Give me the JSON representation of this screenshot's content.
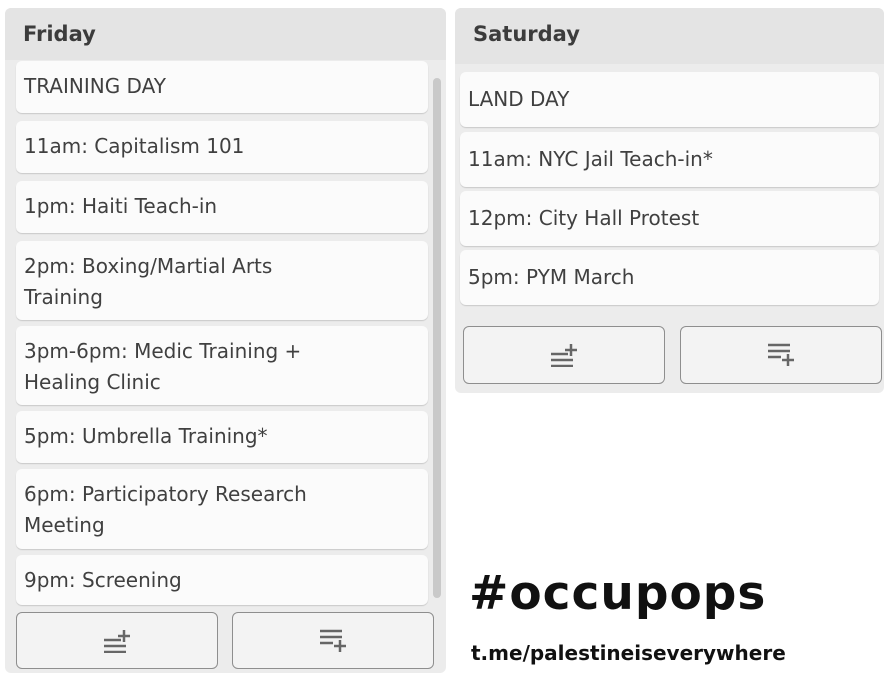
{
  "friday": {
    "title": "Friday",
    "cards": [
      {
        "lines": [
          "TRAINING DAY"
        ]
      },
      {
        "lines": [
          "11am: Capitalism 101"
        ]
      },
      {
        "lines": [
          "1pm: Haiti Teach-in"
        ]
      },
      {
        "lines": [
          "2pm: Boxing/Martial Arts",
          "Training"
        ]
      },
      {
        "lines": [
          "3pm-6pm: Medic Training +",
          "Healing Clinic"
        ]
      },
      {
        "lines": [
          "5pm: Umbrella Training*"
        ]
      },
      {
        "lines": [
          "6pm: Participatory Research",
          "Meeting"
        ]
      },
      {
        "lines": [
          "9pm: Screening"
        ]
      }
    ],
    "buttons": [
      {
        "icon": "add-card-to-top-icon"
      },
      {
        "icon": "add-card-to-bottom-icon"
      }
    ]
  },
  "saturday": {
    "title": "Saturday",
    "cards": [
      {
        "lines": [
          "LAND DAY"
        ]
      },
      {
        "lines": [
          "11am: NYC Jail Teach-in*"
        ]
      },
      {
        "lines": [
          "12pm: City Hall Protest"
        ]
      },
      {
        "lines": [
          "5pm: PYM March"
        ]
      }
    ],
    "buttons": [
      {
        "icon": "add-card-to-top-icon"
      },
      {
        "icon": "add-card-to-bottom-icon"
      }
    ]
  },
  "overlay": {
    "hashtag": "#occupops",
    "link": "t.me/palestineiseverywhere"
  }
}
